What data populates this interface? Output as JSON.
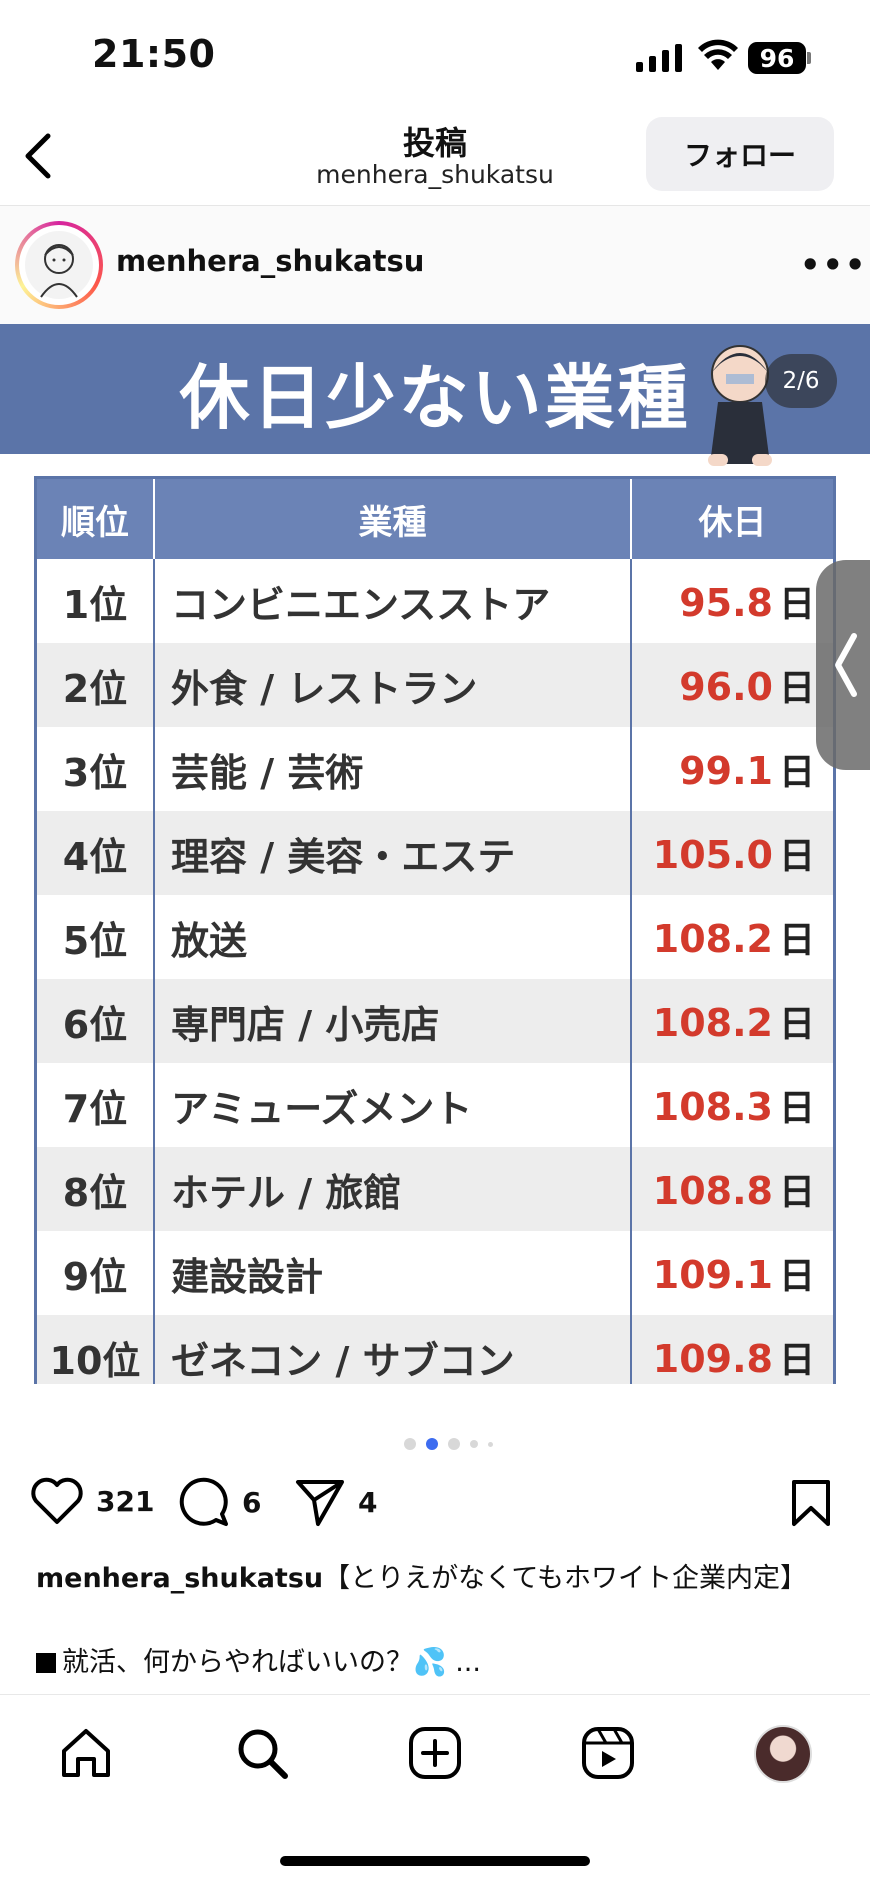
{
  "status": {
    "time": "21:50",
    "battery": "96"
  },
  "header": {
    "title": "投稿",
    "subtitle": "menhera_shukatsu",
    "follow": "フォロー"
  },
  "post": {
    "username": "menhera_shukatsu",
    "counter": "2/6",
    "banner_title": "休日少ない業種",
    "table": {
      "headers": [
        "順位",
        "業種",
        "休日"
      ],
      "rows": [
        {
          "rank": "1位",
          "industry": "コンビニエンスストア",
          "days": "95.8",
          "unit": "日"
        },
        {
          "rank": "2位",
          "industry": "外食 / レストラン",
          "days": "96.0",
          "unit": "日"
        },
        {
          "rank": "3位",
          "industry": "芸能 / 芸術",
          "days": "99.1",
          "unit": "日"
        },
        {
          "rank": "4位",
          "industry": "理容 / 美容・エステ",
          "days": "105.0",
          "unit": "日"
        },
        {
          "rank": "5位",
          "industry": "放送",
          "days": "108.2",
          "unit": "日"
        },
        {
          "rank": "6位",
          "industry": "専門店 / 小売店",
          "days": "108.2",
          "unit": "日"
        },
        {
          "rank": "7位",
          "industry": "アミューズメント",
          "days": "108.3",
          "unit": "日"
        },
        {
          "rank": "8位",
          "industry": "ホテル / 旅館",
          "days": "108.8",
          "unit": "日"
        },
        {
          "rank": "9位",
          "industry": "建設設計",
          "days": "109.1",
          "unit": "日"
        },
        {
          "rank": "10位",
          "industry": "ゼネコン / サブコン",
          "days": "109.8",
          "unit": "日"
        }
      ]
    },
    "accent_color": "#5b74a8",
    "value_color": "#d33a2c"
  },
  "actions": {
    "likes": "321",
    "comments": "6",
    "shares": "4"
  },
  "caption": {
    "username": "menhera_shukatsu",
    "text": "【とりえがなくてもホワイト企業内定】",
    "line2": "就活、何からやればいいの？💦 ..."
  },
  "nav": {
    "items": [
      "home-icon",
      "search-icon",
      "create-icon",
      "reels-icon",
      "profile-avatar"
    ]
  }
}
